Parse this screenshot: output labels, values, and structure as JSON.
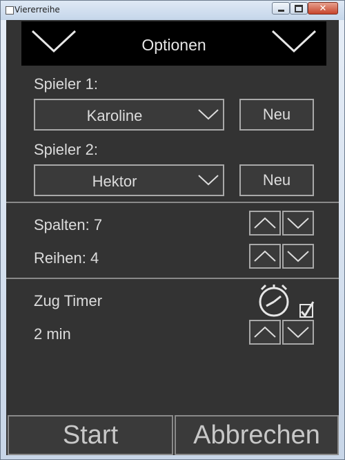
{
  "window": {
    "title": "Viererreihe",
    "close_glyph": "✕"
  },
  "header": {
    "title": "Optionen"
  },
  "players": [
    {
      "label": "Spieler 1:",
      "selected": "Karoline",
      "new_label": "Neu"
    },
    {
      "label": "Spieler 2:",
      "selected": "Hektor",
      "new_label": "Neu"
    }
  ],
  "board": {
    "columns_label": "Spalten: 7",
    "rows_label": "Reihen: 4"
  },
  "timer": {
    "label": "Zug Timer",
    "value_label": "2 min",
    "enabled": true
  },
  "footer": {
    "start_label": "Start",
    "cancel_label": "Abbrechen"
  },
  "colors": {
    "background": "#333333",
    "header_bg": "#000000",
    "border": "#a9a9a9",
    "text": "#dcdcdc"
  },
  "icons": {
    "header_left": "chevron-down-icon",
    "header_right": "chevron-down-icon",
    "timer": "stopwatch-icon",
    "checkbox": "checkmark-icon"
  }
}
